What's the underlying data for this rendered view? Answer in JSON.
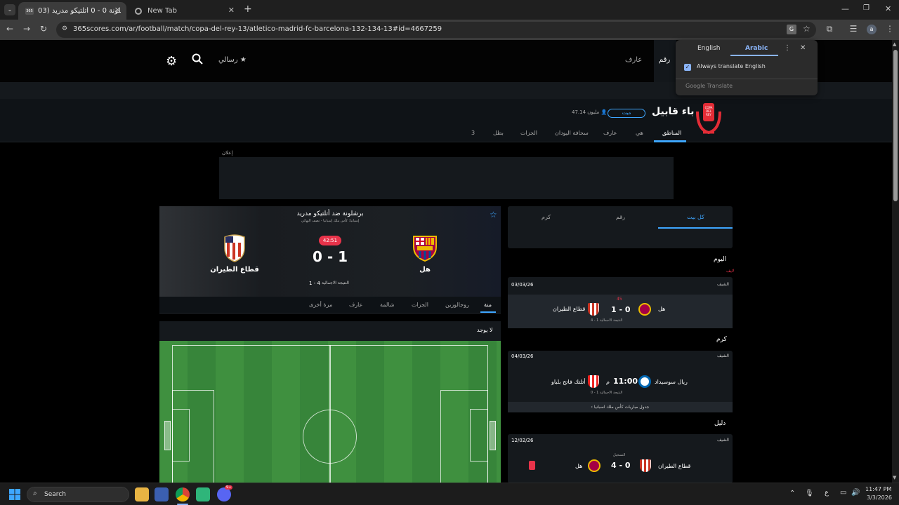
{
  "browser": {
    "tabs": [
      {
        "title": "برشلونة 0 - 0 أتلتيكو مدريد (03/",
        "active": true
      },
      {
        "title": "New Tab",
        "active": false
      }
    ],
    "new_tab": "+",
    "url": "365scores.com/ar/football/match/copa-del-rey-13/atletico-madrid-fc-barcelona-132-134-13#id=4667259"
  },
  "translate_popup": {
    "lang_source": "English",
    "lang_target": "Arabic",
    "always_translate": "Always translate English",
    "footer": "Google Translate"
  },
  "site_nav": {
    "item_1": "رقم",
    "item_2": "عارف",
    "my_label": "رسالي"
  },
  "competition": {
    "name": "باء قابيل",
    "follow": "ميت",
    "followers": "47.14 مليون",
    "logo_text": "COPA DEL REY",
    "tabs": [
      "المناطق",
      "هي",
      "عارف",
      "سحافة اليودان",
      "الجزات",
      "بطل",
      "3"
    ]
  },
  "ad_label": "إعلان",
  "match": {
    "title": "برشلونة ضد أتلتيكو مدريد",
    "subtitle": "إسبانيا: كأس ملك إسبانيا - نصف النهائي",
    "home_team": "هل",
    "away_team": "قطاع الطيران",
    "time_badge": "42:51",
    "score": "0 - 1",
    "aggregate_label": "النتيجة الاجمالية",
    "aggregate_score": "1 - 4",
    "tabs": [
      "منة",
      "روجالوزين",
      "الجزات",
      "شالمة",
      "عارف",
      "مرة أخرى"
    ],
    "lineup_label": "لا يوجد"
  },
  "sidebar": {
    "tabs": [
      "كل بيت",
      "رقم",
      "كرم"
    ],
    "section_today": "اليوم",
    "live_label": "لايف",
    "matches": [
      {
        "league": "الشيف",
        "date": "03/03/26",
        "home": "هل",
        "away": "قطاع الطيران",
        "score": "1 - 0",
        "minute": "45",
        "note": "النتيجة الاجمالية 1 - 4"
      },
      {
        "section": "كرم",
        "league": "الشيف",
        "date": "04/03/26",
        "home": "ريال سوسيداد",
        "away": "أتلتك فاتح بلباو",
        "score": "11:00",
        "suffix": "م",
        "note": "النتيجة الاجمالية 1 - 0"
      },
      {
        "section": "دليل",
        "league": "الشيف",
        "date": "12/02/26",
        "home": "قطاع الطيران",
        "away": "هل",
        "score": "4 - 0",
        "minute": "التسجيل",
        "note": ""
      }
    ],
    "table_link": "جدول مباريات كأس ملك اسبانيا"
  },
  "taskbar": {
    "search": "Search",
    "time": "11:47 PM",
    "date": "3/3/2026",
    "lang": "ع",
    "discord_badge": "9+"
  },
  "colors": {
    "accent": "#3ea6ff",
    "live_red": "#e8334a",
    "pitch_green": "#3c8f3c"
  }
}
